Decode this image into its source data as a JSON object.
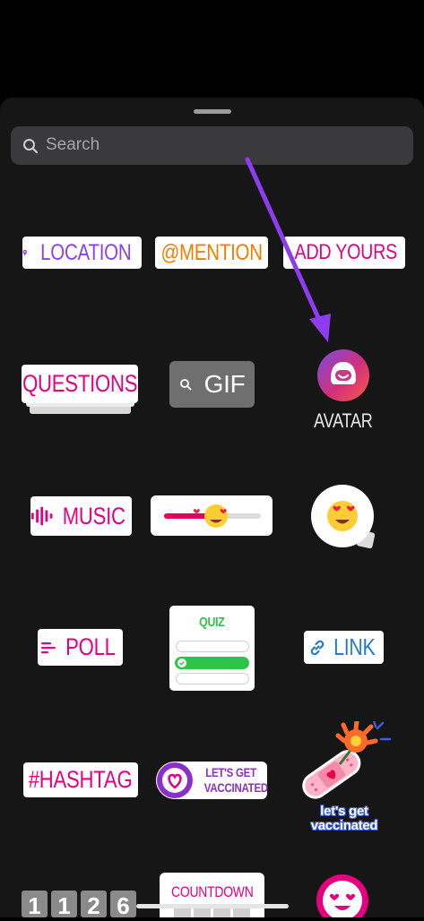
{
  "search": {
    "placeholder": "Search"
  },
  "stickers": {
    "location": "LOCATION",
    "mention": "@MENTION",
    "add_yours": "ADD YOURS",
    "questions": "QUESTIONS",
    "gif": "GIF",
    "avatar": "AVATAR",
    "music": "MUSIC",
    "poll": "POLL",
    "quiz": "QUIZ",
    "link": "LINK",
    "hashtag": "#HASHTAG",
    "vaccinated_line1": "LET'S GET",
    "vaccinated_line2": "VACCINATED",
    "vaccinated_art_line1": "let's get",
    "vaccinated_art_line2": "vaccinated",
    "countdown": "COUNTDOWN",
    "clock_digits": [
      "1",
      "1",
      "2",
      "6"
    ]
  },
  "colors": {
    "purple": "#8a3ffc",
    "orange": "#f57c00",
    "pink": "#e6007e",
    "blue": "#1f7bd6",
    "green": "#2ec44a",
    "arrow": "#8e3cf0"
  }
}
